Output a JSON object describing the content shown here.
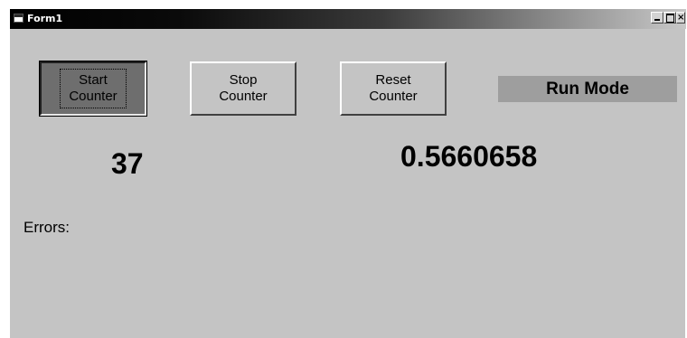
{
  "window": {
    "title": "Form1",
    "minimize_label": "_",
    "maximize_label": "",
    "close_label": "×"
  },
  "buttons": {
    "start": "Start\nCounter",
    "stop": "Stop\nCounter",
    "reset": "Reset\nCounter"
  },
  "status": {
    "mode": "Run Mode"
  },
  "display": {
    "count": "37",
    "value": "0.5660658"
  },
  "errors": {
    "label": "Errors:"
  },
  "colors": {
    "form_background": "#c4c4c4",
    "pressed_button": "#6e6e6e",
    "mode_label_background": "#9e9e9e"
  },
  "icons": {
    "app": "form-app-icon",
    "minimize": "minimize-icon",
    "maximize": "maximize-icon",
    "close": "close-icon"
  }
}
